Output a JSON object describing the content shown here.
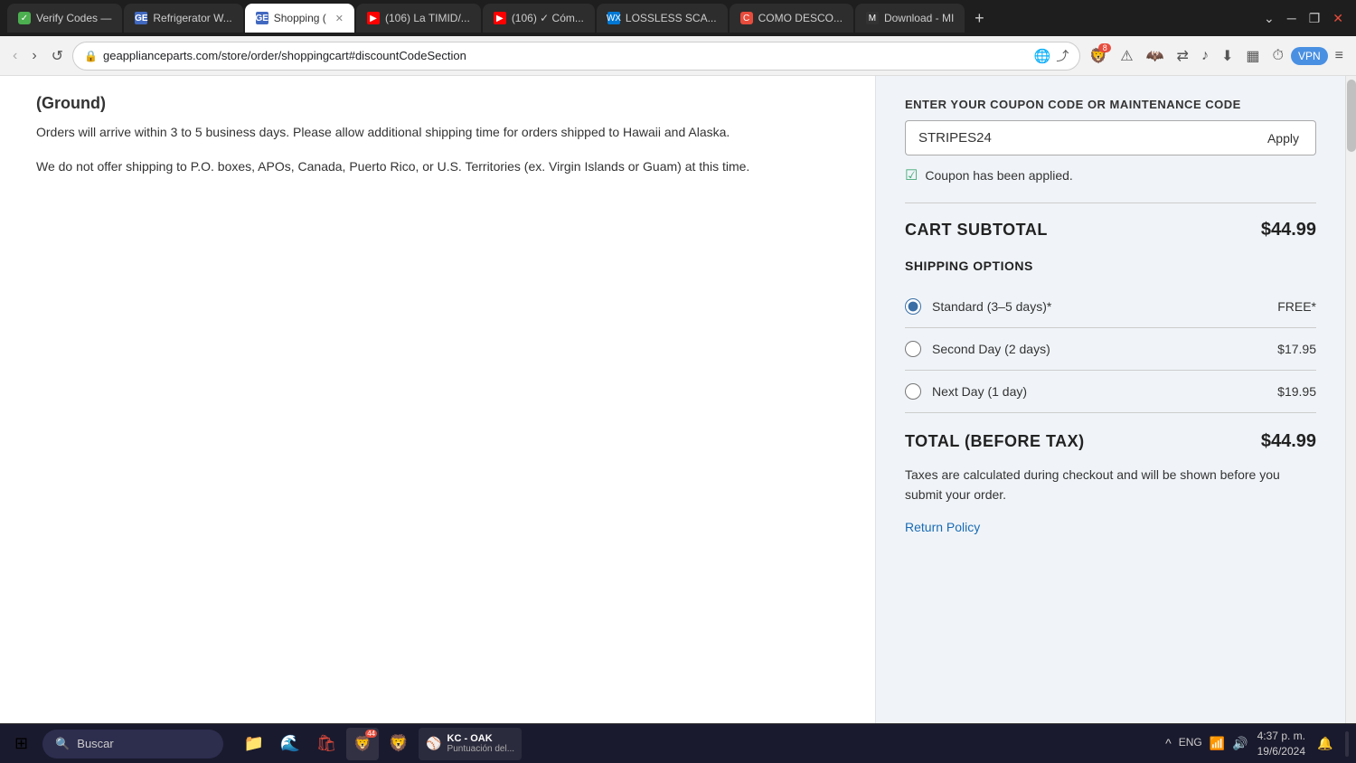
{
  "browser": {
    "tabs": [
      {
        "id": "verify",
        "favicon_char": "✓",
        "favicon_bg": "#4caf50",
        "label": "Verify Codes —",
        "active": false
      },
      {
        "id": "refrigerator",
        "favicon_char": "GE",
        "favicon_bg": "#4169c0",
        "label": "Refrigerator W...",
        "active": false
      },
      {
        "id": "shopping",
        "favicon_char": "GE",
        "favicon_bg": "#4169c0",
        "label": "Shopping (",
        "active": true,
        "closeable": true
      },
      {
        "id": "yt1",
        "favicon_char": "▶",
        "favicon_bg": "#ff0000",
        "label": "(106) La TIMID/...",
        "active": false
      },
      {
        "id": "yt2",
        "favicon_char": "▶",
        "favicon_bg": "#ff0000",
        "label": "(106) ✓ Cóm...",
        "active": false
      },
      {
        "id": "lossless",
        "favicon_char": "WX",
        "favicon_bg": "#0078d4",
        "label": "LOSSLESS SCA...",
        "active": false
      },
      {
        "id": "como",
        "favicon_char": "C",
        "favicon_bg": "#e74c3c",
        "label": "COMO DESCO...",
        "active": false
      },
      {
        "id": "download",
        "favicon_char": "M",
        "favicon_bg": "#333",
        "label": "Download - MI",
        "active": false
      }
    ],
    "url": "geapplianceparts.com/store/order/shoppingcart#discountCodeSection",
    "brave_badge": "8"
  },
  "left_panel": {
    "heading": "(Ground)",
    "paragraph1": "Orders will arrive within 3 to 5 business days. Please allow additional shipping time for orders shipped to Hawaii and Alaska.",
    "paragraph2": "We do not offer shipping to P.O. boxes, APOs, Canada, Puerto Rico, or U.S. Territories (ex. Virgin Islands or Guam) at this time."
  },
  "right_panel": {
    "coupon_label": "ENTER YOUR COUPON CODE OR MAINTENANCE CODE",
    "coupon_value": "STRIPES24",
    "apply_button": "Apply",
    "coupon_applied_text": "Coupon has been applied.",
    "cart_subtotal_label": "CART SUBTOTAL",
    "cart_subtotal_value": "$44.99",
    "shipping_options_label": "SHIPPING OPTIONS",
    "shipping_options": [
      {
        "id": "standard",
        "label": "Standard (3–5 days)*",
        "price": "FREE*",
        "selected": true
      },
      {
        "id": "second_day",
        "label": "Second Day (2 days)",
        "price": "$17.95",
        "selected": false
      },
      {
        "id": "next_day",
        "label": "Next Day (1 day)",
        "price": "$19.95",
        "selected": false
      }
    ],
    "total_label": "TOTAL (BEFORE TAX)",
    "total_value": "$44.99",
    "tax_note": "Taxes are calculated during checkout and will be shown before you submit your order.",
    "return_policy_link": "Return Policy"
  },
  "taskbar": {
    "search_placeholder": "Buscar",
    "clock_time": "4:37 p. m.",
    "clock_date": "19/6/2024",
    "lang": "ENG",
    "baseball_team": "KC - OAK",
    "baseball_score": "Puntuación del...",
    "brave_notif_badge": "44"
  }
}
